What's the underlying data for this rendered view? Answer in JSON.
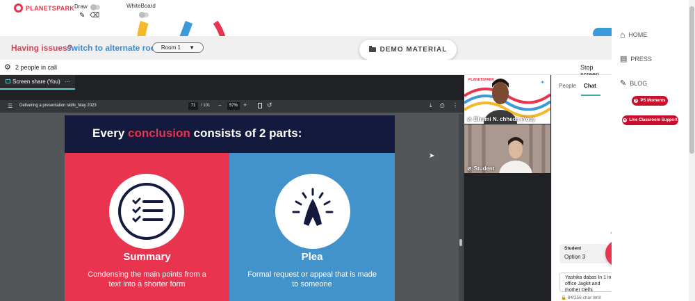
{
  "header": {
    "logo_text": "PLANETSPARK",
    "draw_label": "Draw",
    "whiteboard_label": "WhiteBoard"
  },
  "issue_bar": {
    "question": "Having issues?",
    "action": "switch to alternate room",
    "room_select": "Room 1"
  },
  "demo_button": "DEMO MATERIAL",
  "call_bar": {
    "people_count": "2 people in call",
    "stop_screen": "Stop screen"
  },
  "screen_share": {
    "tab_label": "Screen share (You)",
    "tab_more": "···"
  },
  "pdf_viewer": {
    "doc_title": "Delivering a presentation skills_May 2023",
    "current_page": "71",
    "total_pages": "/ 101",
    "zoom": "57%"
  },
  "slide": {
    "title_before": "Every ",
    "title_accent": "conclusion",
    "title_after": " consists of 2 parts:",
    "left_heading": "Summary",
    "left_desc": "Condensing the main points from a text into a shorter form",
    "right_heading": "Plea",
    "right_desc": "Formal request or appeal that is made to someone"
  },
  "participants": [
    {
      "name": "Bhumi N. chheda (You)"
    },
    {
      "name": "Student"
    }
  ],
  "chat": {
    "tab_people": "People",
    "tab_chat": "Chat",
    "message_sender": "Student",
    "message_text": "Option 3",
    "input_value": "Yashika  dabas In 1 in office Jagkit and mother    Delhi",
    "char_limit": "84/256 char limit"
  },
  "right_nav": {
    "home": "HOME",
    "press": "PRESS",
    "blog": "BLOG",
    "ps_moments": "PS Moments",
    "live_support": "Live Classroom Support"
  },
  "colors": {
    "brand_red": "#e8344e",
    "accent_blue": "#3e8ad1",
    "slide_navy": "#131a3e",
    "slide_blue": "#4292cc",
    "chat_tab_teal": "#3ea89c"
  }
}
